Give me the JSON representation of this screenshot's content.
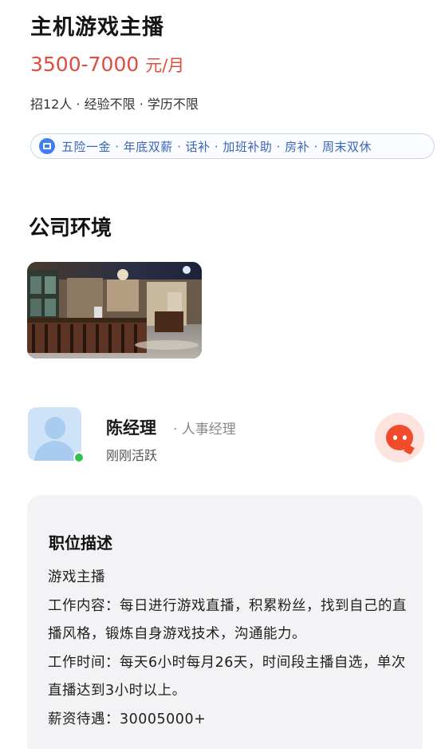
{
  "job": {
    "title": "主机游戏主播",
    "salary_range": "3500-7000",
    "salary_unit": "元/月",
    "requirements": "招12人 · 经验不限 · 学历不限"
  },
  "benefits": {
    "icon": "gift-icon",
    "text": "五险一金 · 年底双薪 · 话补 · 加班补助 · 房补 · 周末双休"
  },
  "environment": {
    "title": "公司环境"
  },
  "recruiter": {
    "name": "陈经理",
    "role": "· 人事经理",
    "status": "刚刚活跃",
    "online": true
  },
  "description": {
    "title": "职位描述",
    "lines": [
      "游戏主播",
      "工作内容：每日进行游戏直播，积累粉丝，找到自己的直播风格，锻炼自身游戏技术，沟通能力。",
      "工作时间：每天6小时每月26天，时间段主播自选，单次直播达到3小时以上。",
      "薪资待遇：30005000+"
    ]
  },
  "colors": {
    "salary": "#e24c3d",
    "benefit_text": "#3a66b8",
    "chat_button": "#f14b2c",
    "online": "#2fc34d"
  }
}
